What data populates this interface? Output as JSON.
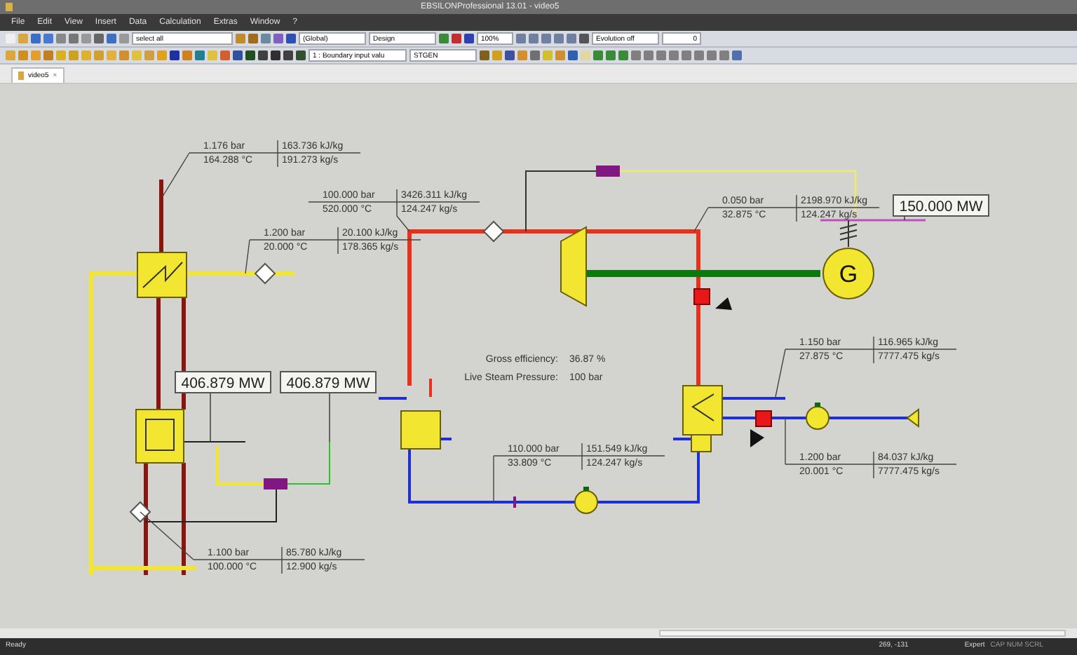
{
  "window": {
    "title": "EBSILONProfessional 13.01 - video5"
  },
  "menu": [
    "File",
    "Edit",
    "View",
    "Insert",
    "Data",
    "Calculation",
    "Extras",
    "Window",
    "?"
  ],
  "toolbar": {
    "selection": "select all",
    "profile": "(Global)",
    "mode": "Design",
    "zoom": "100%",
    "evolution": "Evolution off",
    "counter": "0",
    "boundary": "1 : Boundary input valu",
    "component": "STGEN"
  },
  "tabs": [
    {
      "label": "video5",
      "selected": true,
      "close": "×"
    }
  ],
  "diagram": {
    "stream_values": [
      {
        "pressure": "1.176 bar",
        "temperature": "164.288 °C",
        "enthalpy": "163.736 kJ/kg",
        "mass_flow": "191.273 kg/s"
      },
      {
        "pressure": "1.200 bar",
        "temperature": "20.000 °C",
        "enthalpy": "20.100 kJ/kg",
        "mass_flow": "178.365 kg/s"
      },
      {
        "pressure": "100.000 bar",
        "temperature": "520.000 °C",
        "enthalpy": "3426.311 kJ/kg",
        "mass_flow": "124.247 kg/s"
      },
      {
        "pressure": "0.050 bar",
        "temperature": "32.875 °C",
        "enthalpy": "2198.970 kJ/kg",
        "mass_flow": "124.247 kg/s"
      },
      {
        "pressure": "1.150 bar",
        "temperature": "27.875 °C",
        "enthalpy": "116.965 kJ/kg",
        "mass_flow": "7777.475 kg/s"
      },
      {
        "pressure": "110.000 bar",
        "temperature": "33.809 °C",
        "enthalpy": "151.549 kJ/kg",
        "mass_flow": "124.247 kg/s"
      },
      {
        "pressure": "1.200 bar",
        "temperature": "20.001 °C",
        "enthalpy": "84.037 kJ/kg",
        "mass_flow": "7777.475 kg/s"
      },
      {
        "pressure": "1.100 bar",
        "temperature": "100.000 °C",
        "enthalpy": "85.780 kJ/kg",
        "mass_flow": "12.900 kg/s"
      }
    ],
    "power_displays": [
      "406.879 MW",
      "406.879 MW",
      "150.000 MW"
    ],
    "generator_label": "G",
    "summary": [
      {
        "label": "Gross efficiency:",
        "value": "36.87 %"
      },
      {
        "label": "Live Steam Pressure:",
        "value": "100  bar"
      }
    ]
  },
  "status_bar": {
    "text": "Ready",
    "coordinates": "269, -131",
    "mode": "Expert",
    "indicators": "CAP NUM SCRL"
  }
}
